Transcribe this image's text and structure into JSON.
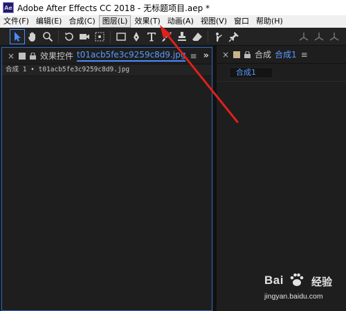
{
  "window": {
    "logo_text": "Ae",
    "title": "Adobe After Effects CC 2018 - 无标题项目.aep *"
  },
  "menu": {
    "items": [
      {
        "label": "文件(F)"
      },
      {
        "label": "编辑(E)"
      },
      {
        "label": "合成(C)"
      },
      {
        "label": "图层(L)",
        "active": true
      },
      {
        "label": "效果(T)"
      },
      {
        "label": "动画(A)"
      },
      {
        "label": "视图(V)"
      },
      {
        "label": "窗口"
      },
      {
        "label": "帮助(H)"
      }
    ]
  },
  "toolbar": {
    "tools": [
      "selection-tool",
      "hand-tool",
      "zoom-tool",
      "rotate-tool",
      "camera-tool",
      "pan-behind-tool",
      "rectangle-tool",
      "pen-tool",
      "type-tool",
      "brush-tool",
      "clone-stamp-tool",
      "eraser-tool",
      "roto-brush-tool",
      "puppet-pin-tool",
      "axis-local-icon",
      "axis-world-icon",
      "axis-view-icon"
    ]
  },
  "effect_panel": {
    "tab_label": "效果控件",
    "file_name": "t01acb5fe3c9259c8d9.jpg",
    "breadcrumb": "合成 1 • t01acb5fe3c9259c8d9.jpg"
  },
  "comp_panel": {
    "tab_label": "合成",
    "comp_name": "合成1",
    "chip_label": "合成1"
  },
  "watermark": {
    "brand": "Bai",
    "brand2": "经验",
    "url": "jingyan.baidu.com"
  },
  "colors": {
    "accent": "#4a8cff",
    "annotation_arrow": "#e0201a"
  }
}
